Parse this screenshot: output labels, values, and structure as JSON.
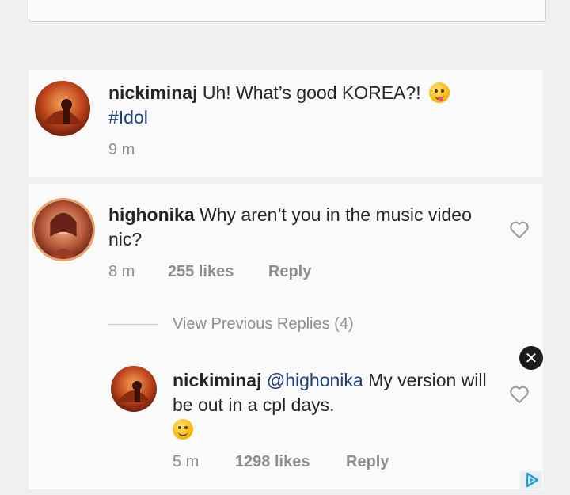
{
  "comments": {
    "main": {
      "username": "nickiminaj",
      "text": "Uh! What’s good KOREA?!",
      "hashtag": "#Idol",
      "time": "9 m"
    },
    "question": {
      "username": "highonika",
      "text": "Why aren’t you in the music video nic?",
      "time": "8 m",
      "likes": "255 likes",
      "reply_label": "Reply"
    },
    "view_previous_replies": "View Previous Replies (4)",
    "reply": {
      "username": "nickiminaj",
      "mention": "@highonika",
      "text": "My version will be out in a cpl days.",
      "time": "5 m",
      "likes": "1298 likes",
      "reply_label": "Reply"
    }
  },
  "close_symbol": "✕",
  "icons": {
    "like": "heart-outline-icon",
    "close": "close-icon",
    "ad": "adchoices-icon",
    "emoji_main": "winking-tongue-emoji-icon",
    "emoji_reply": "smiling-emoji-icon"
  },
  "colors": {
    "text": "#262626",
    "meta": "#8e8e8e",
    "hashtag": "#1a3f7a",
    "background": "#f0f0f0",
    "card": "#fafafa"
  }
}
